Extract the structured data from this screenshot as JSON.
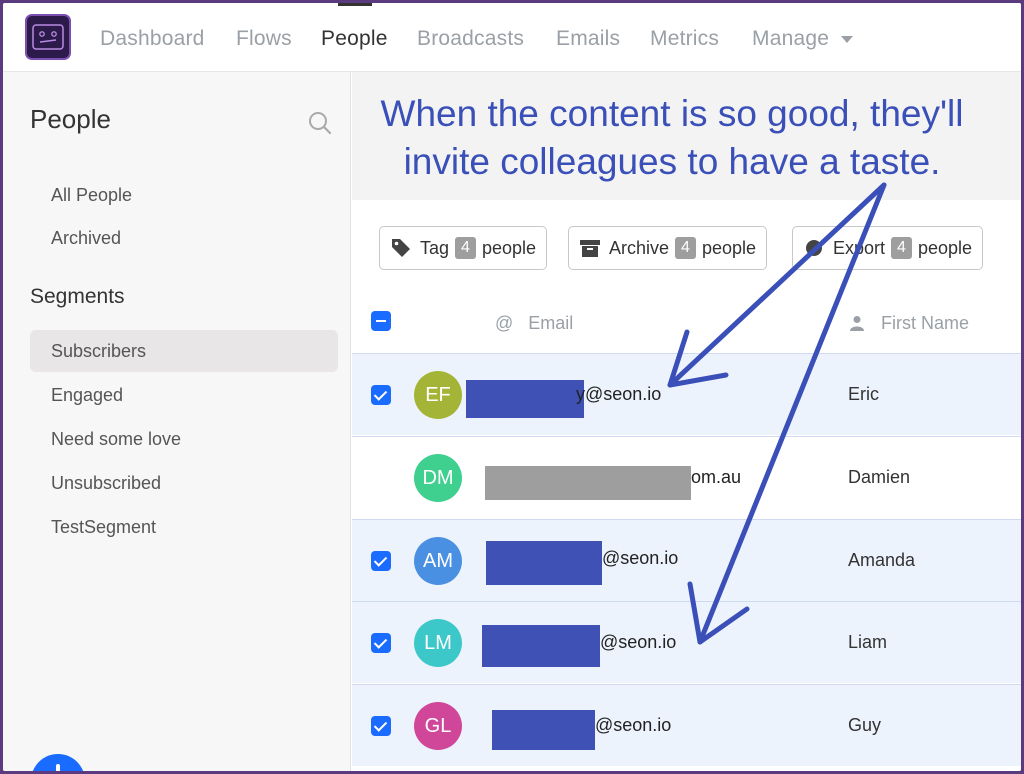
{
  "nav": {
    "items": [
      "Dashboard",
      "Flows",
      "People",
      "Broadcasts",
      "Emails",
      "Metrics",
      "Manage"
    ],
    "active": "People"
  },
  "sidebar": {
    "title": "People",
    "links": [
      "All People",
      "Archived"
    ],
    "segments_title": "Segments",
    "segments": [
      "Subscribers",
      "Engaged",
      "Need some love",
      "Unsubscribed",
      "TestSegment"
    ],
    "active_segment": "Subscribers"
  },
  "annotation": {
    "line1": "When the content is so good, they'll",
    "line2": "invite colleagues to have a taste.",
    "color": "#3a4fb8"
  },
  "actions": [
    {
      "label": "Tag",
      "count": "4",
      "suffix": "people",
      "icon": "tag-icon"
    },
    {
      "label": "Archive",
      "count": "4",
      "suffix": "people",
      "icon": "archive-icon"
    },
    {
      "label": "Export",
      "count": "4",
      "suffix": "people",
      "icon": "export-icon"
    }
  ],
  "table": {
    "columns": [
      "Email",
      "First Name"
    ],
    "rows": [
      {
        "initials": "EF",
        "avatar_color": "#a4b437",
        "email_visible": "y@seon.io",
        "redaction": "#3f51b5",
        "first_name": "Eric",
        "selected": true
      },
      {
        "initials": "DM",
        "avatar_color": "#3fcf8e",
        "email_visible": "om.au",
        "redaction": "#9e9e9e",
        "first_name": "Damien",
        "selected": false
      },
      {
        "initials": "AM",
        "avatar_color": "#4a90e2",
        "email_visible": "@seon.io",
        "redaction": "#3f51b5",
        "first_name": "Amanda",
        "selected": true
      },
      {
        "initials": "LM",
        "avatar_color": "#3cc8c8",
        "email_visible": "@seon.io",
        "redaction": "#3f51b5",
        "first_name": "Liam",
        "selected": true
      },
      {
        "initials": "GL",
        "avatar_color": "#d0479a",
        "email_visible": "@seon.io",
        "redaction": "#3f51b5",
        "first_name": "Guy",
        "selected": true
      }
    ]
  },
  "colors": {
    "accent": "#1a6bff",
    "frame": "#5b3a80"
  }
}
